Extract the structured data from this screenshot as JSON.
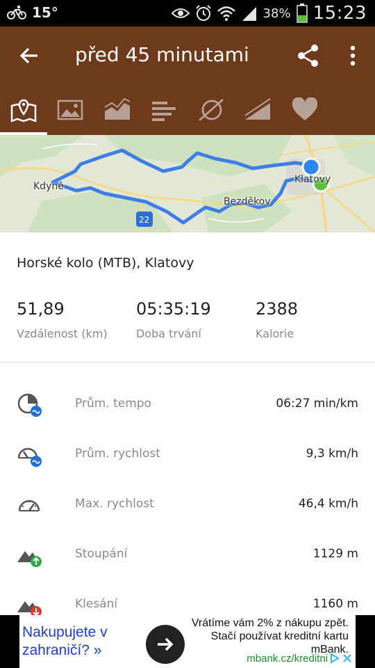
{
  "status_bar": {
    "temperature": "15°",
    "battery_percent": "38%",
    "time": "15:23"
  },
  "app_bar": {
    "title": "před 45 minutami"
  },
  "tabs": [
    {
      "icon": "map-icon",
      "active": true
    },
    {
      "icon": "photo-icon",
      "active": false
    },
    {
      "icon": "chart-icon",
      "active": false
    },
    {
      "icon": "bars-icon",
      "active": false
    },
    {
      "icon": "route-icon",
      "active": false
    },
    {
      "icon": "elevation-icon",
      "active": false
    },
    {
      "icon": "heart-icon",
      "active": false
    }
  ],
  "map": {
    "labels": {
      "kdyne": "Kdyně",
      "klatovy": "Klatovy",
      "bezdekov": "Bezděkov",
      "road": "22"
    },
    "route_color": "#3d7fe6",
    "start_color": "#2e86f0",
    "end_color": "#5cc03a"
  },
  "activity": {
    "title": "Horské kolo (MTB), Klatovy"
  },
  "summary": {
    "distance": {
      "value": "51,89",
      "label": "Vzdálenost (km)"
    },
    "duration": {
      "value": "05:35:19",
      "label": "Doba trvání"
    },
    "calories": {
      "value": "2388",
      "label": "Kalorie"
    }
  },
  "metrics": [
    {
      "icon": "avg-pace-icon",
      "label": "Prům. tempo",
      "value": "06:27 min/km"
    },
    {
      "icon": "avg-speed-icon",
      "label": "Prům. rychlost",
      "value": "9,3 km/h"
    },
    {
      "icon": "max-speed-icon",
      "label": "Max. rychlost",
      "value": "46,4 km/h"
    },
    {
      "icon": "ascent-icon",
      "label": "Stoupání",
      "value": "1129 m"
    },
    {
      "icon": "descent-icon",
      "label": "Klesání",
      "value": "1160 m"
    }
  ],
  "ad": {
    "left_line1": "Nakupujete v",
    "left_line2": "zahraničí? »",
    "right_line1": "Vrátíme vám 2% z nákupu zpět.",
    "right_line2": "Stačí používat kreditní kartu",
    "right_line3": "mBank.",
    "url": "mbank.cz/kreditni"
  },
  "colors": {
    "app_bar": "#6e3a1c",
    "ad_link": "#1f3fd0",
    "ad_url": "#1a8f2a"
  }
}
